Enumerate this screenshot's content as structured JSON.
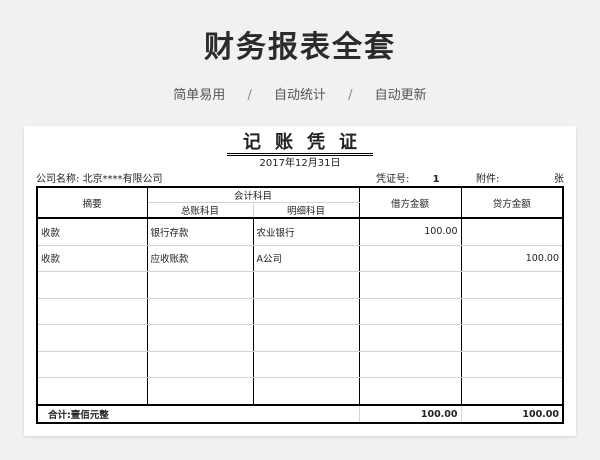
{
  "header": {
    "title": "财务报表全套",
    "features": [
      "简单易用",
      "自动统计",
      "自动更新"
    ],
    "separator": "/"
  },
  "voucher": {
    "title": "记账凭证",
    "date": "2017年12月31日",
    "company_label": "公司名称:",
    "company_name": "北京****有限公司",
    "voucher_no_label": "凭证号:",
    "voucher_no": "1",
    "attachment_label": "附件:",
    "attachment_unit": "张"
  },
  "table": {
    "headers": {
      "summary": "摘要",
      "account_group": "会计科目",
      "general_account": "总账科目",
      "detail_account": "明细科目",
      "debit": "借方金额",
      "credit": "贷方金额"
    },
    "rows": [
      {
        "summary": "收款",
        "general": "银行存款",
        "detail": "农业银行",
        "debit": "100.00",
        "credit": ""
      },
      {
        "summary": "收款",
        "general": "应收账款",
        "detail": "A公司",
        "debit": "",
        "credit": "100.00"
      },
      {
        "summary": "",
        "general": "",
        "detail": "",
        "debit": "",
        "credit": ""
      },
      {
        "summary": "",
        "general": "",
        "detail": "",
        "debit": "",
        "credit": ""
      },
      {
        "summary": "",
        "general": "",
        "detail": "",
        "debit": "",
        "credit": ""
      },
      {
        "summary": "",
        "general": "",
        "detail": "",
        "debit": "",
        "credit": ""
      },
      {
        "summary": "",
        "general": "",
        "detail": "",
        "debit": "",
        "credit": ""
      }
    ],
    "total": {
      "label": "合计:壹佰元整",
      "debit": "100.00",
      "credit": "100.00"
    }
  }
}
